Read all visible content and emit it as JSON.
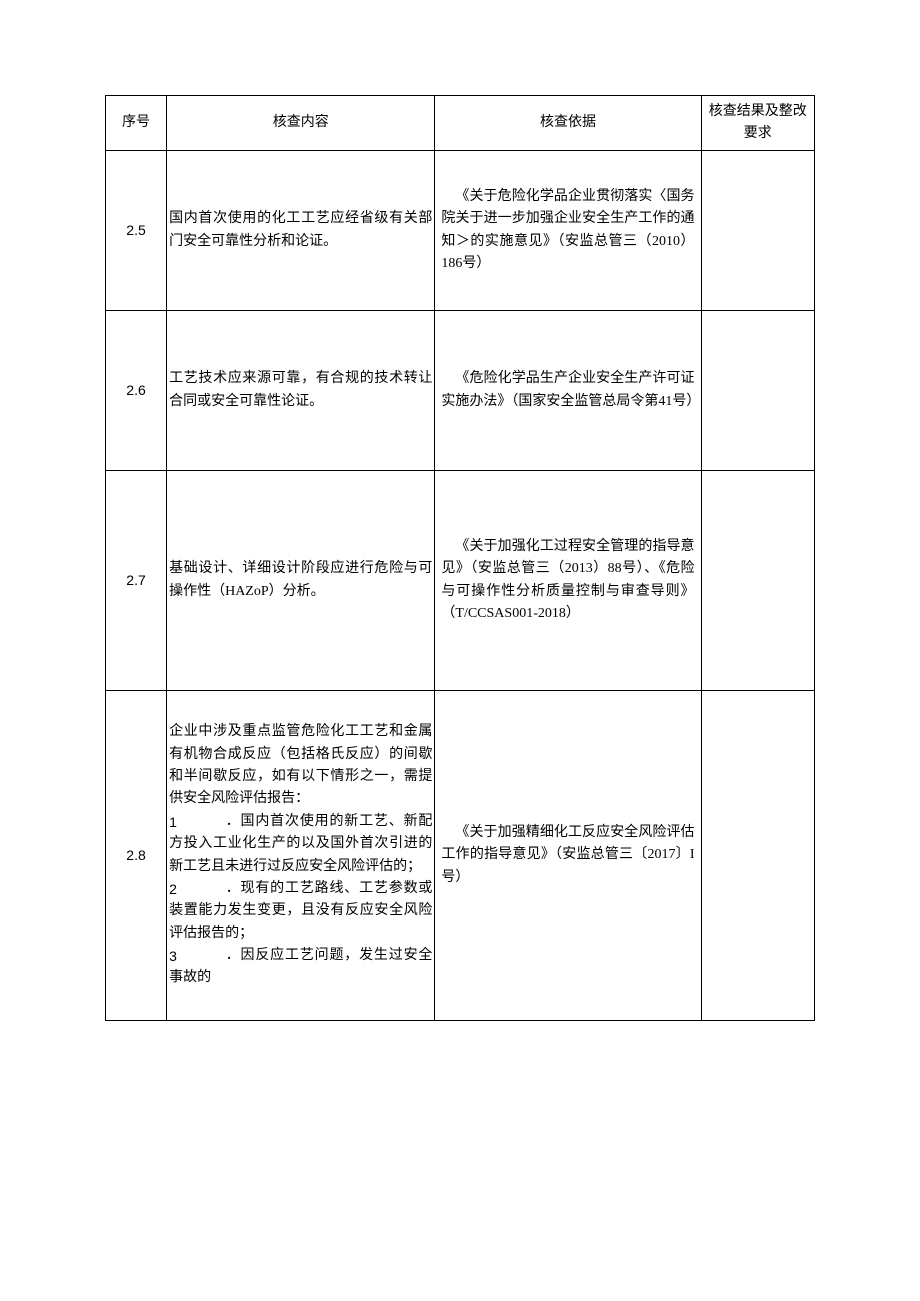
{
  "header": {
    "col_num": "序号",
    "col_content": "核查内容",
    "col_basis": "核查依据",
    "col_result": "核查结果及整改要求"
  },
  "rows": {
    "r25": {
      "num": "2.5",
      "content": "国内首次使用的化工工艺应经省级有关部门安全可靠性分析和论证。",
      "basis_l1": "《关于危险化学品企业贯彻落实〈国务院关于进一步加强企业安全生产工作的通知＞的实施意见》（安监总管三（2010）186号）"
    },
    "r26": {
      "num": "2.6",
      "content": "工艺技术应来源可靠，有合规的技术转让合同或安全可靠性论证。",
      "basis_l1": "《危险化学品生产企业安全生产许可证实施办法》（国家安全监管总局令第41号）"
    },
    "r27": {
      "num": "2.7",
      "content": "基础设计、详细设计阶段应进行危险与可操作性（HAZoP）分析。",
      "basis_l1": "《关于加强化工过程安全管理的指导意见》（安监总管三（2013）88号）、《危险与可操作性分析质量控制与审查导则》（T/CCSAS001-2018）"
    },
    "r28": {
      "num": "2.8",
      "intro": "企业中涉及重点监管危险化工工艺和金属有机物合成反应（包括格氏反应）的间歇和半间歇反应，如有以下情形之一，需提供安全风险评估报告：",
      "item1_num": "1",
      "item1_txt": "．国内首次使用的新工艺、新配方投入工业化生产的以及国外首次引进的新工艺且未进行过反应安全风险评估的；",
      "item2_num": "2",
      "item2_txt": "．现有的工艺路线、工艺参数或装置能力发生变更，且没有反应安全风险评估报告的；",
      "item3_num": "3",
      "item3_txt": "．因反应工艺问题，发生过安全事故的",
      "basis_l1": "《关于加强精细化工反应安全风险评估工作的指导意见》（安监总管三〔2017〕I号）"
    }
  }
}
